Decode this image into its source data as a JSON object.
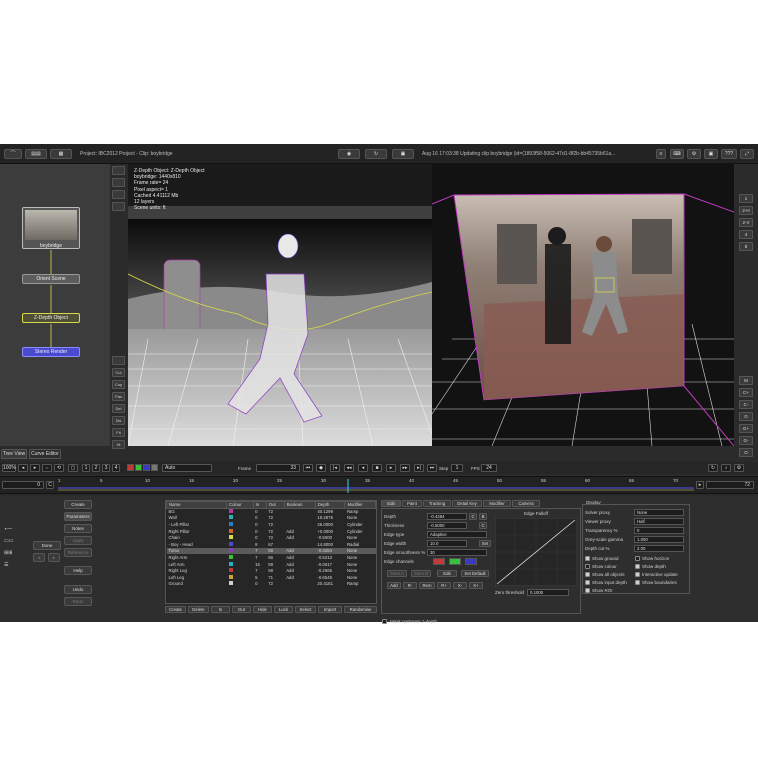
{
  "topbar": {
    "project": "Project: IBC2012 Project - Clip: boybridge",
    "status": "Aug 16 17:03:38 Updating clip boybridge (id=(1893f58-5062-47d1-8f2b-bb45735b61a...",
    "help": "???"
  },
  "node_graph": {
    "thumb_label": "boybridge",
    "orient_scene": "Orient Scene",
    "z_depth_object": "Z-Depth Object",
    "stereo_render": "Stereo Render",
    "side_buttons": [
      "",
      "",
      "",
      "",
      "",
      "Cut",
      "Cop",
      "Pas",
      "Del",
      "Dis",
      "Fit",
      "Hi"
    ]
  },
  "viewer_info": {
    "lines": [
      "Z-Depth Object: Z-Depth Object",
      "boybridge: 1440x810",
      "Frame rate= 24",
      "Pixel aspect= 1",
      "Cached 4.41112 Mb",
      "12 layers",
      "Scene units: ft"
    ]
  },
  "right_toolbar": {
    "top": [
      "1",
      "2-H",
      "2-V",
      "4",
      "8"
    ],
    "bottom": [
      "M",
      "C+",
      "C-",
      "G",
      "G+",
      "G-",
      "O"
    ]
  },
  "tabs": {
    "tree_view": "Tree View",
    "curve_editor": "Curve Editor"
  },
  "frame_bar": {
    "zoom": "100%",
    "pages": [
      "1",
      "2",
      "3",
      "4"
    ],
    "proxy": "Auto",
    "frame_label": "Frame",
    "frame_value": "33",
    "step_label": "Step",
    "step_value": "1",
    "fps_label": "FPS",
    "fps_value": "24"
  },
  "timeline": {
    "start": "0",
    "end": "72",
    "ticks": [
      "1",
      "5",
      "10",
      "15",
      "20",
      "25",
      "30",
      "35",
      "40",
      "45",
      "50",
      "55",
      "60",
      "65",
      "70"
    ]
  },
  "left_buttons": {
    "create": "Create",
    "parameters": "Parameters",
    "notes": "Notes",
    "apply": "Apply",
    "reference": "Reference",
    "done": "Done",
    "help": "Help",
    "undo": "Undo",
    "redo": "Redo"
  },
  "layers": {
    "headers": [
      "Name",
      "Colour",
      "In",
      "Out",
      "Boolean",
      "Depth",
      "Modifier"
    ],
    "rows": [
      {
        "name": "BG",
        "colour": "#b03aa8",
        "in": "0",
        "out": "72",
        "boolean": "",
        "depth": "40.1299",
        "modifier": "Ramp"
      },
      {
        "name": "Wall",
        "colour": "#2bb0b4",
        "in": "0",
        "out": "72",
        "boolean": "",
        "depth": "19.2875",
        "modifier": "None"
      },
      {
        "name": "- Left Pillar",
        "colour": "#2a7ec4",
        "in": "0",
        "out": "72",
        "boolean": "",
        "depth": "26.0000",
        "modifier": "Cylinder"
      },
      {
        "name": "Right Pillar",
        "colour": "#d06a2a",
        "in": "0",
        "out": "72",
        "boolean": "Add",
        "depth": "+0.0000",
        "modifier": "Cylinder"
      },
      {
        "name": "Chain",
        "colour": "#d8d84a",
        "in": "0",
        "out": "72",
        "boolean": "Add",
        "depth": "-0.5000",
        "modifier": "None"
      },
      {
        "name": "- Boy - Head",
        "colour": "#4a4ad0",
        "in": "8",
        "out": "67",
        "boolean": "",
        "depth": "14.8000",
        "modifier": "Radial"
      },
      {
        "name": "Torso",
        "colour": "#8a3ac0",
        "in": "7",
        "out": "68",
        "boolean": "Add",
        "depth": "-0.4284",
        "modifier": "None"
      },
      {
        "name": "Right Arm",
        "colour": "#3ac03a",
        "in": "7",
        "out": "66",
        "boolean": "Add",
        "depth": "-0.5213",
        "modifier": "None"
      },
      {
        "name": "Left Arm",
        "colour": "#2ab0c0",
        "in": "15",
        "out": "59",
        "boolean": "Add",
        "depth": "-0.0617",
        "modifier": "None"
      },
      {
        "name": "Right Leg",
        "colour": "#c03a3a",
        "in": "7",
        "out": "68",
        "boolean": "Add",
        "depth": "-0.2565",
        "modifier": "None"
      },
      {
        "name": "Left Leg",
        "colour": "#d0a03a",
        "in": "5",
        "out": "71",
        "boolean": "Add",
        "depth": "-0.6545",
        "modifier": "None"
      },
      {
        "name": "Ground",
        "colour": "#d0d0d0",
        "in": "0",
        "out": "72",
        "boolean": "",
        "depth": "20.4181",
        "modifier": "Ramp"
      }
    ],
    "actions": [
      "Create",
      "Delete",
      "In",
      "Out",
      "Hide",
      "Lock",
      "Select",
      "Import",
      "Randomise"
    ],
    "mask_label": "Mask upstream z-depth"
  },
  "edit_panel": {
    "tabs": [
      "Edit",
      "Paint",
      "Tracking",
      "Detail Key",
      "Modifier",
      "Camera"
    ],
    "depth_label": "Depth",
    "depth_value": "-0.4284",
    "thickness_label": "Thickness",
    "thickness_value": "-0.5000",
    "edge_type_label": "Edge type",
    "edge_type_value": "Adaptive",
    "edge_width_label": "Edge width",
    "edge_width_value": "10.0",
    "edge_smooth_label": "Edge smoothness %",
    "edge_smooth_value": "30",
    "edge_channels_label": "Edge channels",
    "set_label": "Set",
    "c_label": "C",
    "b_label": "B",
    "buttons_row1": [
      "Store A",
      "Store B",
      "Edit",
      "Set Default"
    ],
    "buttons_row2": [
      "Add",
      "R-",
      "Rem",
      "R+",
      "X-",
      "X+"
    ],
    "edge_falloff_title": "Edge Falloff",
    "zero_threshold_label": "Zero threshold",
    "zero_threshold_value": "0.1000"
  },
  "display_panel": {
    "title": "Display",
    "solver_proxy_label": "Solver proxy",
    "solver_proxy_value": "None",
    "viewer_proxy_label": "Viewer proxy",
    "viewer_proxy_value": "Half",
    "transparency_label": "Transparency %",
    "transparency_value": "0",
    "grey_gamma_label": "Grey-scale gamma",
    "grey_gamma_value": "1.000",
    "depth_cut_label": "Depth cut %",
    "depth_cut_value": "2.00",
    "checks_left": [
      "Show ground",
      "Show colour",
      "Show all objects",
      "Show input depth",
      "Show ROI"
    ],
    "checks_right": [
      "Show horizon",
      "Show depth",
      "Interactive update",
      "Show boundaries"
    ]
  }
}
